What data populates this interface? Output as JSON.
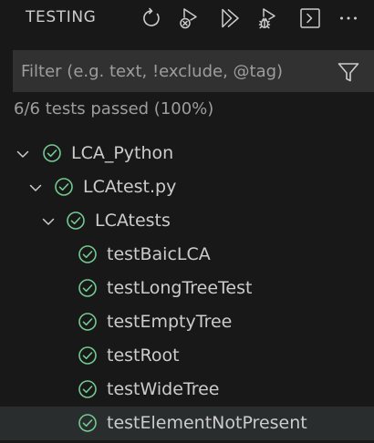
{
  "header": {
    "title": "TESTING",
    "toolbar": [
      {
        "name": "refresh-tests-icon"
      },
      {
        "name": "clear-results-icon"
      },
      {
        "name": "run-all-tests-icon"
      },
      {
        "name": "debug-tests-icon"
      },
      {
        "name": "show-output-icon"
      },
      {
        "name": "more-actions-icon"
      }
    ]
  },
  "filter": {
    "placeholder": "Filter (e.g. text, !exclude, @tag)",
    "value": ""
  },
  "summary": "6/6 tests passed (100%)",
  "tree": {
    "root": {
      "label": "LCA_Python",
      "status": "passed",
      "expanded": true
    },
    "file": {
      "label": "LCAtest.py",
      "status": "passed",
      "expanded": true
    },
    "suite": {
      "label": "LCAtests",
      "status": "passed",
      "expanded": true
    },
    "tests": [
      {
        "label": "testBaicLCA",
        "status": "passed"
      },
      {
        "label": "testLongTreeTest",
        "status": "passed"
      },
      {
        "label": "testEmptyTree",
        "status": "passed"
      },
      {
        "label": "testRoot",
        "status": "passed"
      },
      {
        "label": "testWideTree",
        "status": "passed"
      },
      {
        "label": "testElementNotPresent",
        "status": "passed"
      }
    ]
  },
  "colors": {
    "passed": "#73c991",
    "background": "#181818",
    "input_background": "#313131",
    "selected_row": "#2a2d2e"
  }
}
